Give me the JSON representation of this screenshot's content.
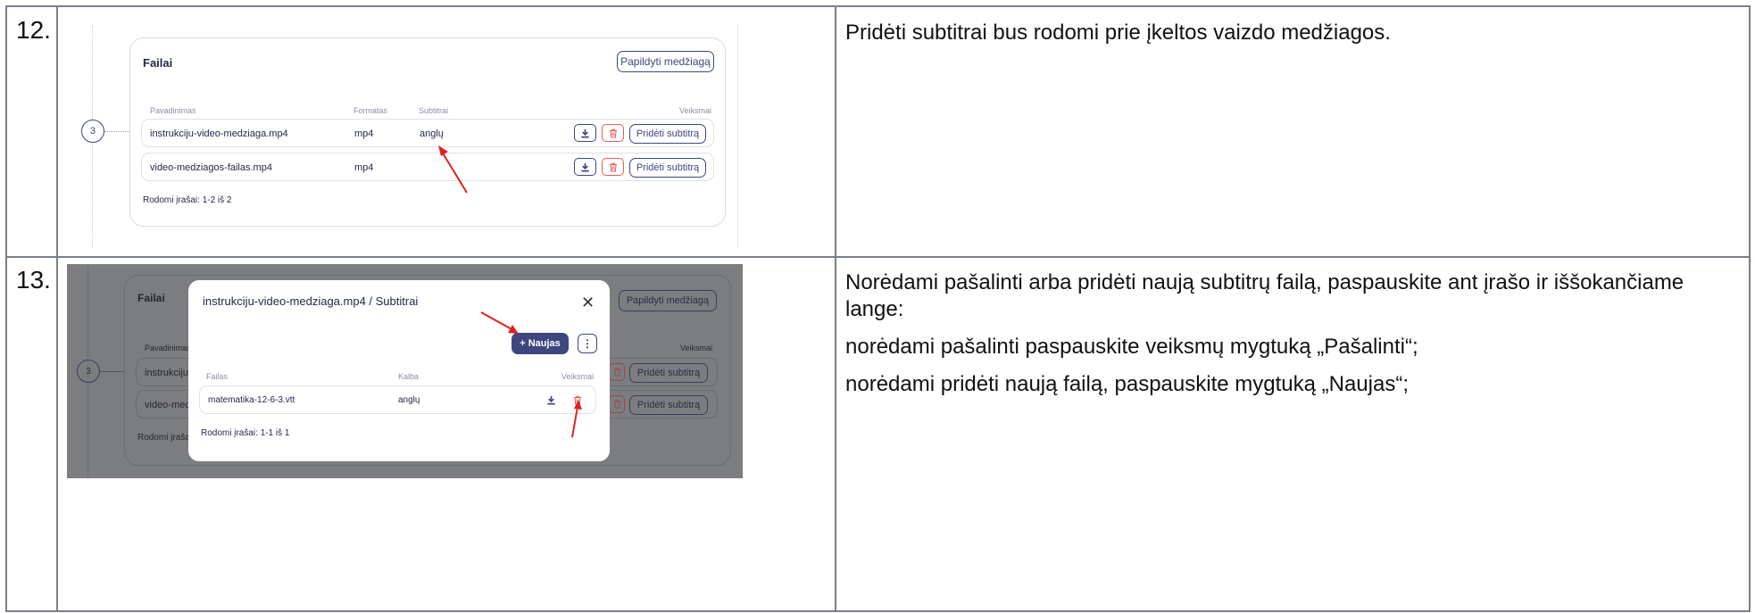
{
  "rows": [
    {
      "number": "12.",
      "screenshot": {
        "card_title": "Failai",
        "add_button": "Papildyti medžiagą",
        "step": "3",
        "columns": {
          "name": "Pavadinimas",
          "format": "Formatas",
          "subtitles": "Subtitrai",
          "actions": "Veiksmai"
        },
        "files": [
          {
            "name": "instrukciju-video-medziaga.mp4",
            "format": "mp4",
            "subtitles": "anglų",
            "action": "Pridėti subtitrą"
          },
          {
            "name": "video-medziagos-failas.mp4",
            "format": "mp4",
            "subtitles": "",
            "action": "Pridėti subtitrą"
          }
        ],
        "footer": "Rodomi įrašai: 1-2 iš 2"
      },
      "description": [
        "Pridėti subtitrai bus rodomi prie įkeltos vaizdo medžiagos."
      ]
    },
    {
      "number": "13.",
      "screenshot": {
        "background": {
          "card_title": "Failai",
          "add_button": "Papildyti medžiagą",
          "step": "3",
          "col_name": "Pavadinimas",
          "col_actions": "Veiksmai",
          "row1_name": "instrukciju-v",
          "row2_name": "video-medzi",
          "action": "Pridėti subtitrą",
          "footer": "Rodomi įrašai:"
        },
        "modal": {
          "title": "instrukciju-video-medziaga.mp4 / Subtitrai",
          "close": "✕",
          "new_button": "+ Naujas",
          "more_button": "⋮",
          "columns": {
            "file": "Failas",
            "language": "Kalba",
            "actions": "Veiksmai"
          },
          "items": [
            {
              "file": "matematika-12-6-3.vtt",
              "language": "anglų"
            }
          ],
          "footer": "Rodomi įrašai: 1-1 iš 1"
        }
      },
      "description": [
        "Norėdami pašalinti arba pridėti naują subtitrų failą, paspauskite ant įrašo ir iššokančiame lange:",
        "norėdami pašalinti paspauskite veiksmų mygtuką „Pašalinti“;",
        "norėdami pridėti naują failą, paspauskite mygtuką „Naujas“;"
      ]
    }
  ],
  "colors": {
    "primary": "#3e4680",
    "danger": "#e85b5b",
    "arrow": "#e02020",
    "border": "#7a7f88"
  },
  "icons": [
    "download-icon",
    "trash-icon",
    "close-icon",
    "more-vertical-icon",
    "arrow-annotation"
  ]
}
